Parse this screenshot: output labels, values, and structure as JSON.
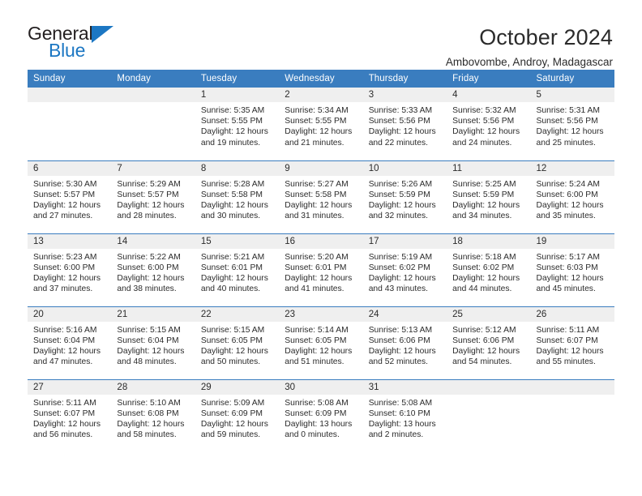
{
  "logo": {
    "general": "General",
    "blue": "Blue",
    "triangle_color": "#1c77c3"
  },
  "header": {
    "title": "October 2024",
    "subtitle": "Ambovombe, Androy, Madagascar"
  },
  "theme": {
    "header_blue": "#3a7dbf",
    "daynum_band": "#efefef",
    "text": "#2b2b2b"
  },
  "weekdays": [
    "Sunday",
    "Monday",
    "Tuesday",
    "Wednesday",
    "Thursday",
    "Friday",
    "Saturday"
  ],
  "weeks": [
    [
      {
        "day": "",
        "empty": true
      },
      {
        "day": "",
        "empty": true
      },
      {
        "day": "1",
        "sunrise": "Sunrise: 5:35 AM",
        "sunset": "Sunset: 5:55 PM",
        "daylight1": "Daylight: 12 hours",
        "daylight2": "and 19 minutes."
      },
      {
        "day": "2",
        "sunrise": "Sunrise: 5:34 AM",
        "sunset": "Sunset: 5:55 PM",
        "daylight1": "Daylight: 12 hours",
        "daylight2": "and 21 minutes."
      },
      {
        "day": "3",
        "sunrise": "Sunrise: 5:33 AM",
        "sunset": "Sunset: 5:56 PM",
        "daylight1": "Daylight: 12 hours",
        "daylight2": "and 22 minutes."
      },
      {
        "day": "4",
        "sunrise": "Sunrise: 5:32 AM",
        "sunset": "Sunset: 5:56 PM",
        "daylight1": "Daylight: 12 hours",
        "daylight2": "and 24 minutes."
      },
      {
        "day": "5",
        "sunrise": "Sunrise: 5:31 AM",
        "sunset": "Sunset: 5:56 PM",
        "daylight1": "Daylight: 12 hours",
        "daylight2": "and 25 minutes."
      }
    ],
    [
      {
        "day": "6",
        "sunrise": "Sunrise: 5:30 AM",
        "sunset": "Sunset: 5:57 PM",
        "daylight1": "Daylight: 12 hours",
        "daylight2": "and 27 minutes."
      },
      {
        "day": "7",
        "sunrise": "Sunrise: 5:29 AM",
        "sunset": "Sunset: 5:57 PM",
        "daylight1": "Daylight: 12 hours",
        "daylight2": "and 28 minutes."
      },
      {
        "day": "8",
        "sunrise": "Sunrise: 5:28 AM",
        "sunset": "Sunset: 5:58 PM",
        "daylight1": "Daylight: 12 hours",
        "daylight2": "and 30 minutes."
      },
      {
        "day": "9",
        "sunrise": "Sunrise: 5:27 AM",
        "sunset": "Sunset: 5:58 PM",
        "daylight1": "Daylight: 12 hours",
        "daylight2": "and 31 minutes."
      },
      {
        "day": "10",
        "sunrise": "Sunrise: 5:26 AM",
        "sunset": "Sunset: 5:59 PM",
        "daylight1": "Daylight: 12 hours",
        "daylight2": "and 32 minutes."
      },
      {
        "day": "11",
        "sunrise": "Sunrise: 5:25 AM",
        "sunset": "Sunset: 5:59 PM",
        "daylight1": "Daylight: 12 hours",
        "daylight2": "and 34 minutes."
      },
      {
        "day": "12",
        "sunrise": "Sunrise: 5:24 AM",
        "sunset": "Sunset: 6:00 PM",
        "daylight1": "Daylight: 12 hours",
        "daylight2": "and 35 minutes."
      }
    ],
    [
      {
        "day": "13",
        "sunrise": "Sunrise: 5:23 AM",
        "sunset": "Sunset: 6:00 PM",
        "daylight1": "Daylight: 12 hours",
        "daylight2": "and 37 minutes."
      },
      {
        "day": "14",
        "sunrise": "Sunrise: 5:22 AM",
        "sunset": "Sunset: 6:00 PM",
        "daylight1": "Daylight: 12 hours",
        "daylight2": "and 38 minutes."
      },
      {
        "day": "15",
        "sunrise": "Sunrise: 5:21 AM",
        "sunset": "Sunset: 6:01 PM",
        "daylight1": "Daylight: 12 hours",
        "daylight2": "and 40 minutes."
      },
      {
        "day": "16",
        "sunrise": "Sunrise: 5:20 AM",
        "sunset": "Sunset: 6:01 PM",
        "daylight1": "Daylight: 12 hours",
        "daylight2": "and 41 minutes."
      },
      {
        "day": "17",
        "sunrise": "Sunrise: 5:19 AM",
        "sunset": "Sunset: 6:02 PM",
        "daylight1": "Daylight: 12 hours",
        "daylight2": "and 43 minutes."
      },
      {
        "day": "18",
        "sunrise": "Sunrise: 5:18 AM",
        "sunset": "Sunset: 6:02 PM",
        "daylight1": "Daylight: 12 hours",
        "daylight2": "and 44 minutes."
      },
      {
        "day": "19",
        "sunrise": "Sunrise: 5:17 AM",
        "sunset": "Sunset: 6:03 PM",
        "daylight1": "Daylight: 12 hours",
        "daylight2": "and 45 minutes."
      }
    ],
    [
      {
        "day": "20",
        "sunrise": "Sunrise: 5:16 AM",
        "sunset": "Sunset: 6:04 PM",
        "daylight1": "Daylight: 12 hours",
        "daylight2": "and 47 minutes."
      },
      {
        "day": "21",
        "sunrise": "Sunrise: 5:15 AM",
        "sunset": "Sunset: 6:04 PM",
        "daylight1": "Daylight: 12 hours",
        "daylight2": "and 48 minutes."
      },
      {
        "day": "22",
        "sunrise": "Sunrise: 5:15 AM",
        "sunset": "Sunset: 6:05 PM",
        "daylight1": "Daylight: 12 hours",
        "daylight2": "and 50 minutes."
      },
      {
        "day": "23",
        "sunrise": "Sunrise: 5:14 AM",
        "sunset": "Sunset: 6:05 PM",
        "daylight1": "Daylight: 12 hours",
        "daylight2": "and 51 minutes."
      },
      {
        "day": "24",
        "sunrise": "Sunrise: 5:13 AM",
        "sunset": "Sunset: 6:06 PM",
        "daylight1": "Daylight: 12 hours",
        "daylight2": "and 52 minutes."
      },
      {
        "day": "25",
        "sunrise": "Sunrise: 5:12 AM",
        "sunset": "Sunset: 6:06 PM",
        "daylight1": "Daylight: 12 hours",
        "daylight2": "and 54 minutes."
      },
      {
        "day": "26",
        "sunrise": "Sunrise: 5:11 AM",
        "sunset": "Sunset: 6:07 PM",
        "daylight1": "Daylight: 12 hours",
        "daylight2": "and 55 minutes."
      }
    ],
    [
      {
        "day": "27",
        "sunrise": "Sunrise: 5:11 AM",
        "sunset": "Sunset: 6:07 PM",
        "daylight1": "Daylight: 12 hours",
        "daylight2": "and 56 minutes."
      },
      {
        "day": "28",
        "sunrise": "Sunrise: 5:10 AM",
        "sunset": "Sunset: 6:08 PM",
        "daylight1": "Daylight: 12 hours",
        "daylight2": "and 58 minutes."
      },
      {
        "day": "29",
        "sunrise": "Sunrise: 5:09 AM",
        "sunset": "Sunset: 6:09 PM",
        "daylight1": "Daylight: 12 hours",
        "daylight2": "and 59 minutes."
      },
      {
        "day": "30",
        "sunrise": "Sunrise: 5:08 AM",
        "sunset": "Sunset: 6:09 PM",
        "daylight1": "Daylight: 13 hours",
        "daylight2": "and 0 minutes."
      },
      {
        "day": "31",
        "sunrise": "Sunrise: 5:08 AM",
        "sunset": "Sunset: 6:10 PM",
        "daylight1": "Daylight: 13 hours",
        "daylight2": "and 2 minutes."
      },
      {
        "day": "",
        "empty": true
      },
      {
        "day": "",
        "empty": true
      }
    ]
  ]
}
